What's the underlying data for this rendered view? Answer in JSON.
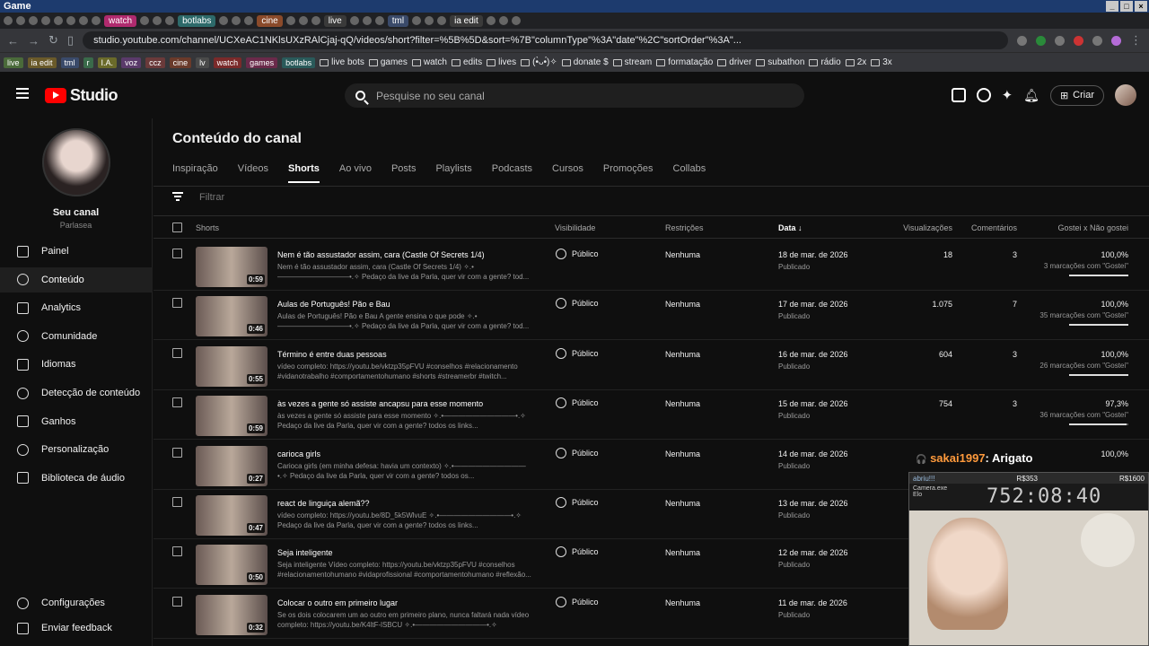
{
  "os": {
    "title": "Game"
  },
  "browser": {
    "tabs": [
      "watch",
      "botlabs",
      "cine",
      "live",
      "tml",
      "ia edit"
    ],
    "url": "studio.youtube.com/channel/UCXeAC1NKlsUXzRAlCjaj-qQ/videos/short?filter=%5B%5D&sort=%7B\"columnType\"%3A\"date\"%2C\"sortOrder\"%3A\"...",
    "bookmark_chips": [
      "live",
      "ia edit",
      "tml",
      "r",
      "I.A.",
      "voz",
      "ccz",
      "cine",
      "lv",
      "watch",
      "games",
      "botlabs"
    ],
    "bookmark_folders": [
      "live bots",
      "games",
      "watch",
      "edits",
      "lives",
      "(•̀ᴗ•́)✧",
      "donate $",
      "stream",
      "formatação",
      "driver",
      "subathon",
      "rádio",
      "2x",
      "3x"
    ]
  },
  "header": {
    "logo_text": "Studio",
    "search_placeholder": "Pesquise no seu canal",
    "create_label": "Criar"
  },
  "channel": {
    "name": "Seu canal",
    "handle": "Parlasea"
  },
  "sidebar": {
    "items": [
      {
        "label": "Painel",
        "icon": "dashboard-icon"
      },
      {
        "label": "Conteúdo",
        "icon": "content-icon"
      },
      {
        "label": "Analytics",
        "icon": "analytics-icon"
      },
      {
        "label": "Comunidade",
        "icon": "community-icon"
      },
      {
        "label": "Idiomas",
        "icon": "languages-icon"
      },
      {
        "label": "Detecção de conteúdo",
        "icon": "content-detection-icon"
      },
      {
        "label": "Ganhos",
        "icon": "earnings-icon"
      },
      {
        "label": "Personalização",
        "icon": "customization-icon"
      },
      {
        "label": "Biblioteca de áudio",
        "icon": "audio-library-icon"
      }
    ],
    "settings": "Configurações",
    "feedback": "Enviar feedback"
  },
  "main": {
    "title": "Conteúdo do canal",
    "tabs": [
      "Inspiração",
      "Vídeos",
      "Shorts",
      "Ao vivo",
      "Posts",
      "Playlists",
      "Podcasts",
      "Cursos",
      "Promoções",
      "Collabs"
    ],
    "active_tab": "Shorts",
    "filter_placeholder": "Filtrar",
    "columns": {
      "shorts": "Shorts",
      "visibility": "Visibilidade",
      "restrictions": "Restrições",
      "date": "Data",
      "views": "Visualizações",
      "comments": "Comentários",
      "likes": "Gostei x Não gostei"
    },
    "rows": [
      {
        "title": "Nem é tão assustador assim, cara (Castle Of Secrets 1/4)",
        "desc": "Nem é tão assustador assim, cara (Castle Of Secrets 1/4) ✧.•——————————•.✧ Pedaço da live da Parla, quer vir com a gente? tod...",
        "duration": "0:59",
        "visibility": "Público",
        "restrictions": "Nenhuma",
        "date": "18 de mar. de 2026",
        "status": "Publicado",
        "views": "18",
        "comments": "3",
        "like_pct": "100,0%",
        "likes": "3 marcações com \"Gostei\"",
        "like_frac": 1.0
      },
      {
        "title": "Aulas de Português! Pão e Bau",
        "desc": "Aulas de Português! Pão e Bau A gente ensina o que pode ✧.•——————————•.✧ Pedaço da live da Parla, quer vir com a gente? tod...",
        "duration": "0:46",
        "visibility": "Público",
        "restrictions": "Nenhuma",
        "date": "17 de mar. de 2026",
        "status": "Publicado",
        "views": "1.075",
        "comments": "7",
        "like_pct": "100,0%",
        "likes": "35 marcações com \"Gostei\"",
        "like_frac": 1.0
      },
      {
        "title": "Término é entre duas pessoas",
        "desc": "vídeo completo: https://youtu.be/vktzp35pFVU #conselhos #relacionamento #vidanotrabalho #comportamentohumano #shorts #streamerbr #twitch...",
        "duration": "0:55",
        "visibility": "Público",
        "restrictions": "Nenhuma",
        "date": "16 de mar. de 2026",
        "status": "Publicado",
        "views": "604",
        "comments": "3",
        "like_pct": "100,0%",
        "likes": "26 marcações com \"Gostei\"",
        "like_frac": 1.0
      },
      {
        "title": "às vezes a gente só assiste ancapsu para esse momento",
        "desc": "às vezes a gente só assiste para esse momento ✧.•——————————•.✧ Pedaço da live da Parla, quer vir com a gente? todos os links...",
        "duration": "0:59",
        "visibility": "Público",
        "restrictions": "Nenhuma",
        "date": "15 de mar. de 2026",
        "status": "Publicado",
        "views": "754",
        "comments": "3",
        "like_pct": "97,3%",
        "likes": "36 marcações com \"Gostei\"",
        "like_frac": 0.973
      },
      {
        "title": "carioca girls",
        "desc": "Carioca girls (em minha defesa: havia um contexto) ✧.•——————————•.✧ Pedaço da live da Parla, quer vir com a gente? todos os...",
        "duration": "0:27",
        "visibility": "Público",
        "restrictions": "Nenhuma",
        "date": "14 de mar. de 2026",
        "status": "Publicado",
        "views": "",
        "comments": "",
        "like_pct": "100,0%",
        "likes": "",
        "like_frac": 1.0
      },
      {
        "title": "react de linguiça alemã??",
        "desc": "vídeo completo: https://youtu.be/8D_5k5WlvuE ✧.•——————————•.✧ Pedaço da live da Parla, quer vir com a gente? todos os links...",
        "duration": "0:47",
        "visibility": "Público",
        "restrictions": "Nenhuma",
        "date": "13 de mar. de 2026",
        "status": "Publicado",
        "views": "",
        "comments": "",
        "like_pct": "",
        "likes": "",
        "like_frac": null
      },
      {
        "title": "Seja inteligente",
        "desc": "Seja inteligente Vídeo completo: https://youtu.be/vktzp35pFVU #conselhos #relacionamentohumano #vidaprofissional #comportamentohumano #reflexão...",
        "duration": "0:50",
        "visibility": "Público",
        "restrictions": "Nenhuma",
        "date": "12 de mar. de 2026",
        "status": "Publicado",
        "views": "",
        "comments": "",
        "like_pct": "",
        "likes": "",
        "like_frac": null
      },
      {
        "title": "Colocar o outro em primeiro lugar",
        "desc": "Se os dois colocarem um ao outro em primeiro plano, nunca faltará nada vídeo completo: https://youtu.be/K4ltF-lSBCU ✧.•——————————•.✧",
        "duration": "0:32",
        "visibility": "Público",
        "restrictions": "Nenhuma",
        "date": "11 de mar. de 2026",
        "status": "Publicado",
        "views": "",
        "comments": "",
        "like_pct": "",
        "likes": "",
        "like_frac": null
      }
    ]
  },
  "overlay": {
    "chat_user": "sakai1997",
    "chat_msg": ": Arigato",
    "cam_left": "abriu!!!",
    "cam_mid": "R$353",
    "cam_right": "R$1600",
    "cam_label": "Camera.exe",
    "cam_sub": "Elo",
    "timer": "752:08:40"
  },
  "colors": {
    "accent_red": "#ff0000",
    "bg": "#0f0f0f",
    "chat_user": "#ff9a3c"
  }
}
